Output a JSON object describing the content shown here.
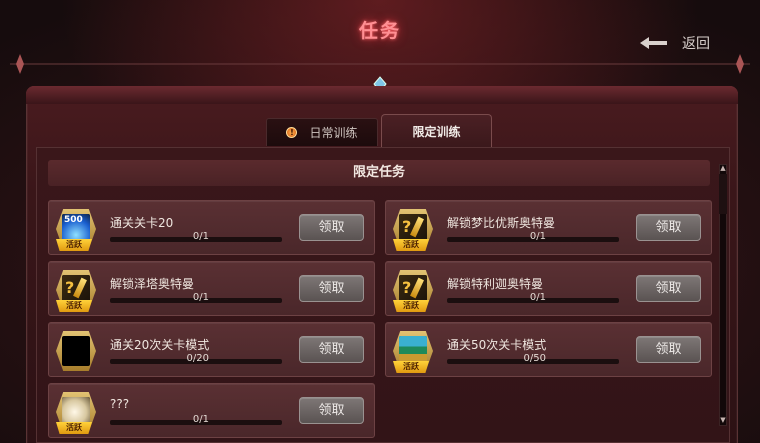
{
  "header": {
    "title": "任务",
    "back_label": "返回"
  },
  "tabs": [
    {
      "label": "日常训练",
      "badge": "!"
    },
    {
      "label": "限定训练"
    }
  ],
  "section_title": "限定任务",
  "tasks": [
    {
      "title": "通关关卡20",
      "progress": "0/1",
      "button": "领取",
      "icon": "500-currency-icon",
      "tag": "活跃",
      "icon_text": "500"
    },
    {
      "title": "解锁梦比优斯奥特曼",
      "progress": "0/1",
      "button": "领取",
      "icon": "ultraman-unlock-icon",
      "tag": "活跃"
    },
    {
      "title": "解锁泽塔奥特曼",
      "progress": "0/1",
      "button": "领取",
      "icon": "ultraman-unlock-icon",
      "tag": "活跃"
    },
    {
      "title": "解锁特利迦奥特曼",
      "progress": "0/1",
      "button": "领取",
      "icon": "ultraman-unlock-icon",
      "tag": "活跃"
    },
    {
      "title": "通关20次关卡模式",
      "progress": "0/20",
      "button": "领取",
      "icon": "empty-reward-icon"
    },
    {
      "title": "通关50次关卡模式",
      "progress": "0/50",
      "button": "领取",
      "icon": "treasure-chest-icon",
      "tag": "活跃"
    },
    {
      "title": "???",
      "progress": "0/1",
      "button": "领取",
      "icon": "egg-reward-icon",
      "tag": "活跃"
    }
  ],
  "colors": {
    "title_glow": "#ff8f93",
    "button": "#6b6463",
    "panel": "#3a171a",
    "tag": "#ffd23a"
  }
}
